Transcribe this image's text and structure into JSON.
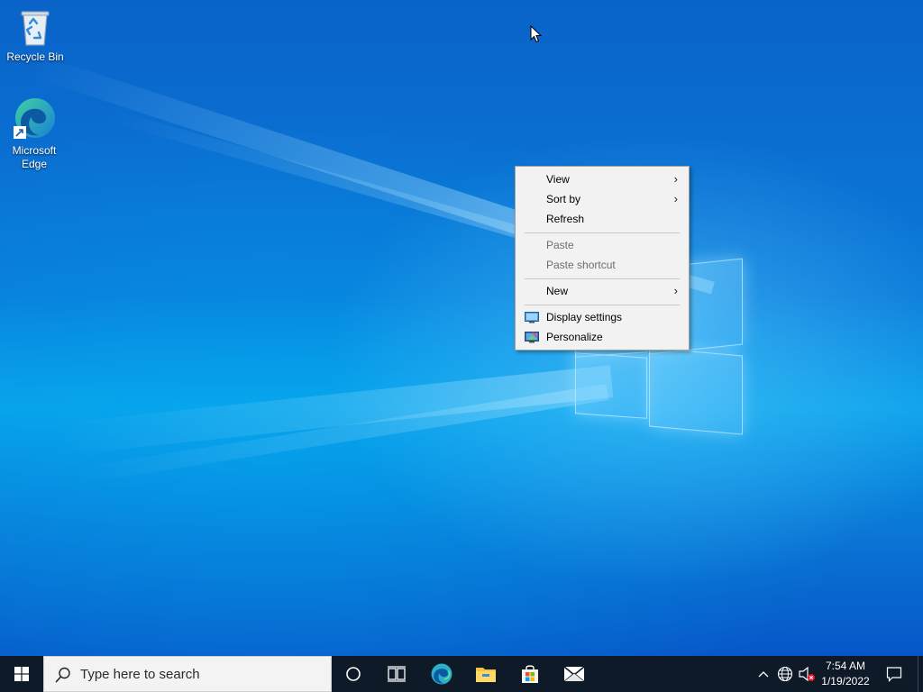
{
  "desktop": {
    "icons": [
      {
        "label": "Recycle Bin",
        "icon": "recycle-bin-icon"
      },
      {
        "label": "Microsoft\nEdge",
        "icon": "edge-icon"
      }
    ]
  },
  "context_menu": {
    "items": [
      {
        "label": "View",
        "has_submenu": true,
        "enabled": true
      },
      {
        "label": "Sort by",
        "has_submenu": true,
        "enabled": true
      },
      {
        "label": "Refresh",
        "has_submenu": false,
        "enabled": true
      },
      {
        "label": "Paste",
        "has_submenu": false,
        "enabled": false
      },
      {
        "label": "Paste shortcut",
        "has_submenu": false,
        "enabled": false
      },
      {
        "label": "New",
        "has_submenu": true,
        "enabled": true
      },
      {
        "label": "Display settings",
        "has_submenu": false,
        "enabled": true,
        "icon": "display-icon"
      },
      {
        "label": "Personalize",
        "has_submenu": false,
        "enabled": true,
        "icon": "personalize-icon"
      }
    ],
    "submenu_glyph": "›"
  },
  "taskbar": {
    "search_placeholder": "Type here to search",
    "pinned": [
      "cortana-icon",
      "task-view-icon",
      "edge-icon",
      "file-explorer-icon",
      "store-icon",
      "mail-icon"
    ],
    "tray": {
      "time": "7:54 AM",
      "date": "1/19/2022"
    }
  },
  "colors": {
    "taskbar_bg": "#0e1a28",
    "menu_bg": "#f2f2f2",
    "disabled_text": "#6d6d6d"
  }
}
